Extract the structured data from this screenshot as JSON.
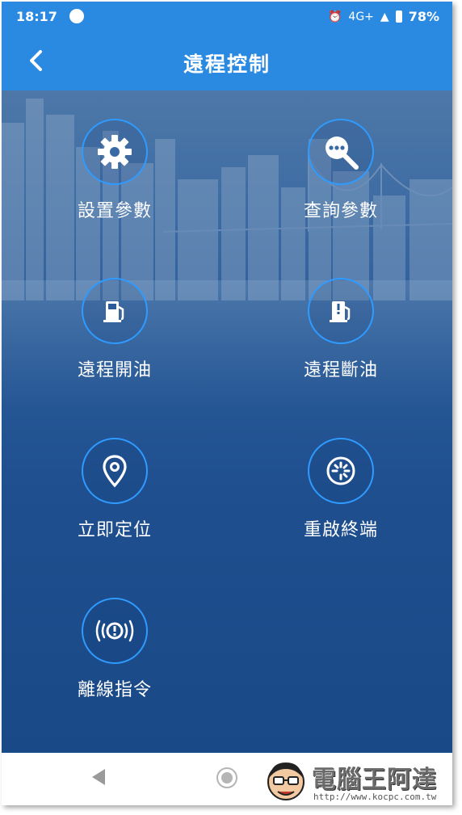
{
  "status_bar": {
    "time": "18:17",
    "network": "4G+",
    "battery": "78%"
  },
  "app_bar": {
    "title": "遠程控制"
  },
  "items": [
    {
      "label": "設置參數",
      "icon": "gear-icon"
    },
    {
      "label": "查詢參數",
      "icon": "search-dots-icon"
    },
    {
      "label": "遠程開油",
      "icon": "fuel-pump-icon"
    },
    {
      "label": "遠程斷油",
      "icon": "fuel-pump-alert-icon"
    },
    {
      "label": "立即定位",
      "icon": "location-pin-icon"
    },
    {
      "label": "重啟終端",
      "icon": "restart-icon"
    },
    {
      "label": "離線指令",
      "icon": "broadcast-alert-icon"
    }
  ],
  "watermark": {
    "title": "電腦王阿達",
    "url": "http://www.kocpc.com.tw"
  },
  "colors": {
    "app_bar": "#2a8ae2",
    "circle_border": "#2f9bff",
    "background": "#1f4f8f"
  }
}
